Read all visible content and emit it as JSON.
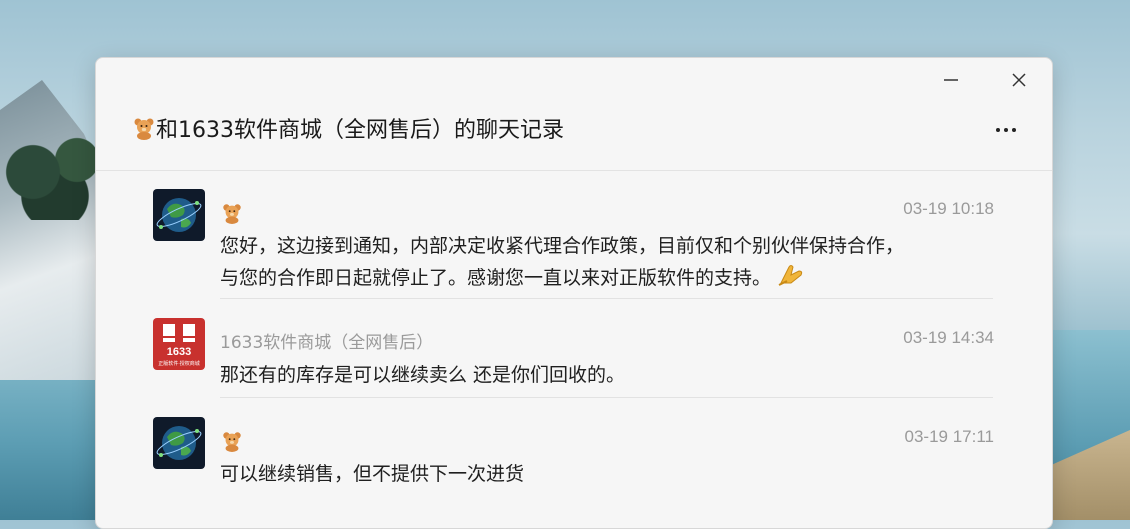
{
  "window": {
    "title": "和1633软件商城（全网售后）的聊天记录",
    "title_icon": "bear-emoji-icon",
    "controls": {
      "minimize": "—",
      "close": "✕",
      "more": "more-options-icon"
    }
  },
  "messages": [
    {
      "sender_icon": "bear-emoji-icon",
      "avatar": "earth-globe-avatar",
      "time": "03-19 10:18",
      "text_line1": "您好，这边接到通知，内部决定收紧代理合作政策，目前仅和个别伙伴保持合作，",
      "text_line2": "与您的合作即日起就停止了。感谢您一直以来对正版软件的支持。",
      "trailing_emoji": "praying-hands-emoji"
    },
    {
      "sender_name": "1633软件商城（全网售后）",
      "avatar": "1633-store-logo-avatar",
      "avatar_logo_text": "1633",
      "avatar_logo_subtext": "正版软件·授权商城",
      "time": "03-19 14:34",
      "text_line1": "那还有的库存是可以继续卖么 还是你们回收的。"
    },
    {
      "sender_icon": "bear-emoji-icon",
      "avatar": "earth-globe-avatar",
      "time": "03-19 17:11",
      "text_line1": "可以继续销售，但不提供下一次进货"
    }
  ],
  "colors": {
    "window_bg": "#f6f6f6",
    "meta_gray": "#9a9a9a",
    "logo_red": "#c8312e"
  }
}
